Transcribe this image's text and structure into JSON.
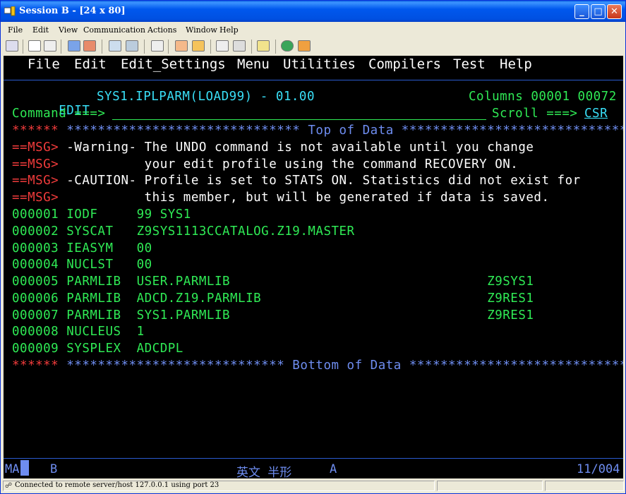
{
  "window": {
    "title": "Session B - [24 x 80]"
  },
  "menubar": [
    "File",
    "Edit",
    "View",
    "Communication",
    "Actions",
    "Window",
    "Help"
  ],
  "ispf_menu": [
    "File",
    "Edit",
    "Edit_Settings",
    "Menu",
    "Utilities",
    "Compilers",
    "Test",
    "Help"
  ],
  "header": {
    "mode": "EDIT",
    "dataset": "SYS1.IPLPARM(LOAD99) - 01.00",
    "columns_label": "Columns",
    "columns_from": "00001",
    "columns_to": "00072",
    "command_prompt": "Command ===>",
    "scroll_prompt": "Scroll ===>",
    "scroll_value": "CSR"
  },
  "top_of_data": {
    "marker": "******",
    "line": "****************************** Top of Data ******************************"
  },
  "messages": [
    {
      "tag": "==MSG>",
      "text": "-Warning- The UNDO command is not available until you change"
    },
    {
      "tag": "==MSG>",
      "text": "          your edit profile using the command RECOVERY ON."
    },
    {
      "tag": "==MSG>",
      "text": "-CAUTION- Profile is set to STATS ON. Statistics did not exist for"
    },
    {
      "tag": "==MSG>",
      "text": "          this member, but will be generated if data is saved."
    }
  ],
  "data_lines": [
    {
      "num": "000001",
      "text": "IODF     99 SYS1"
    },
    {
      "num": "000002",
      "text": "SYSCAT   Z9SYS1113CCATALOG.Z19.MASTER"
    },
    {
      "num": "000003",
      "text": "IEASYM   00"
    },
    {
      "num": "000004",
      "text": "NUCLST   00"
    },
    {
      "num": "000005",
      "text": "PARMLIB  USER.PARMLIB                                 Z9SYS1"
    },
    {
      "num": "000006",
      "text": "PARMLIB  ADCD.Z19.PARMLIB                             Z9RES1"
    },
    {
      "num": "000007",
      "text": "PARMLIB  SYS1.PARMLIB                                 Z9RES1"
    },
    {
      "num": "000008",
      "text": "NUCLEUS  1"
    },
    {
      "num": "000009",
      "text": "SYSPLEX  ADCDPL"
    }
  ],
  "bottom_of_data": {
    "marker": "******",
    "line": "**************************** Bottom of Data ****************************"
  },
  "oia": {
    "left": "MA",
    "mode": "B",
    "ime": "英文 半形",
    "char": "A",
    "cursor_pos": "11/004"
  },
  "status": {
    "text": "Connected to remote server/host 127.0.0.1 using port 23"
  }
}
